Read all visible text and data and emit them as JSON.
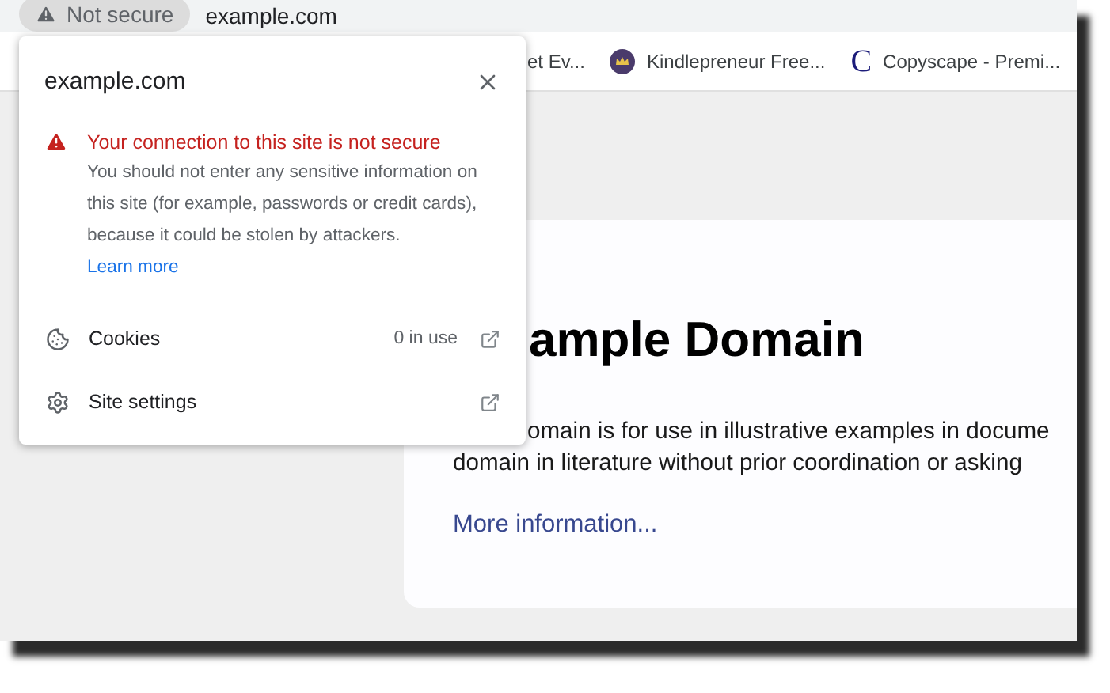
{
  "address_bar": {
    "security_chip": "Not secure",
    "url": "example.com"
  },
  "bookmarks": [
    {
      "kind": "none",
      "label": "et Ev..."
    },
    {
      "kind": "crown",
      "label": "Kindlepreneur Free..."
    },
    {
      "kind": "letter",
      "icon_text": "C",
      "label": "Copyscape - Premi..."
    }
  ],
  "page": {
    "heading": "ample Domain",
    "paragraph_lines": [
      "omain is for use in illustrative examples in docume",
      "domain in literature without prior coordination or asking"
    ],
    "link": "More information..."
  },
  "site_info_popup": {
    "title": "example.com",
    "warning": {
      "title": "Your connection to this site is not secure",
      "body": "You should not enter any sensitive information on this site (for example, passwords or credit cards), because it could be stolen by attackers.",
      "link": "Learn more"
    },
    "rows": [
      {
        "kind": "cookies",
        "label": "Cookies",
        "value": "0 in use"
      },
      {
        "kind": "settings",
        "label": "Site settings"
      }
    ]
  }
}
